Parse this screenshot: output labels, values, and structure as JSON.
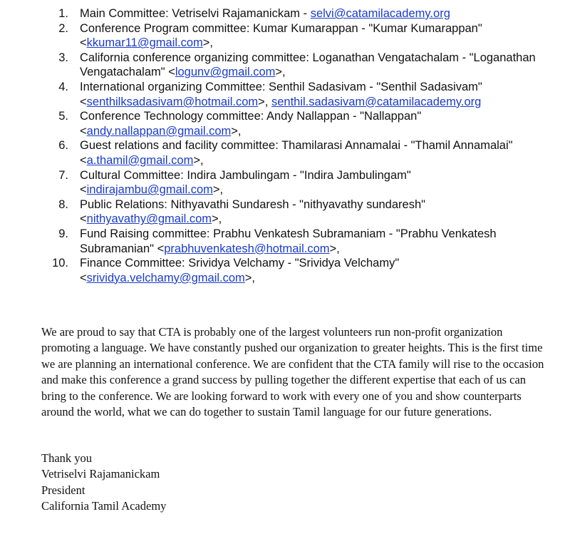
{
  "committees": [
    {
      "number": "1.",
      "text": "Main Committee: Vetriselvi Rajamanickam - ",
      "email": "selvi@catamilacademy.org",
      "suffix": ""
    },
    {
      "number": "2.",
      "text": "Conference Program committee: Kumar Kumarappan - \"Kumar Kumarappan\" <",
      "email": "kkumar11@gmail.com",
      "suffix": ">,"
    },
    {
      "number": "3.",
      "text": "California conference organizing committee: Loganathan Vengatachalam - \"Loganathan Vengatachalam\" <",
      "email": "logunv@gmail.com",
      "suffix": ">,"
    },
    {
      "number": "4.",
      "text": "International organizing Committee: Senthil Sadasivam - \"Senthil Sadasivam\" <",
      "email": "senthilksadasivam@hotmail.com",
      "middle": ">, ",
      "email2": "senthil.sadasivam@catamilacademy.org",
      "suffix": ""
    },
    {
      "number": "5.",
      "text": "Conference Technology committee: Andy Nallappan - \"Nallappan\" <",
      "email": "andy.nallappan@gmail.com",
      "suffix": ">,"
    },
    {
      "number": "6.",
      "text": "Guest relations and facility committee: Thamilarasi Annamalai -  \"Thamil Annamalai\" <",
      "email": "a.thamil@gmail.com",
      "suffix": ">,"
    },
    {
      "number": "7.",
      "text": "Cultural Committee: Indira Jambulingam - \"Indira Jambulingam\" <",
      "email": "indirajambu@gmail.com",
      "suffix": ">,"
    },
    {
      "number": "8.",
      "text": "Public Relations: Nithyavathi Sundaresh - \"nithyavathy sundaresh\" <",
      "email": "nithyavathy@gmail.com",
      "suffix": ">,"
    },
    {
      "number": "9.",
      "text": "Fund Raising committee: Prabhu Venkatesh Subramaniam - \"Prabhu Venkatesh Subramanian\" <",
      "email": "prabhuvenkatesh@hotmail.com",
      "suffix": ">,"
    },
    {
      "number": "10.",
      "text": "Finance Committee: Srividya Velchamy - \"Srividya Velchamy\" <",
      "email": "srividya.velchamy@gmail.com",
      "suffix": ">,"
    }
  ],
  "letter": {
    "paragraph": "We are proud to say that CTA is probably one of the largest volunteers run non-profit organization promoting a language. We have constantly pushed our organization to greater heights. This is the first time we are planning an international conference. We are confident that the CTA family will rise to the occasion and make this conference a grand success by pulling together the different expertise that each of us can bring to the conference.  We are looking forward to work with every one of you and show counterparts around the world, what we can do together to sustain Tamil language for our future generations.",
    "closing": "Thank you",
    "signer_name": "Vetriselvi Rajamanickam",
    "signer_title": "President",
    "organization": "California Tamil Academy"
  },
  "colors": {
    "link": "#1a3cc9",
    "text": "#111111",
    "background": "#ffffff"
  }
}
